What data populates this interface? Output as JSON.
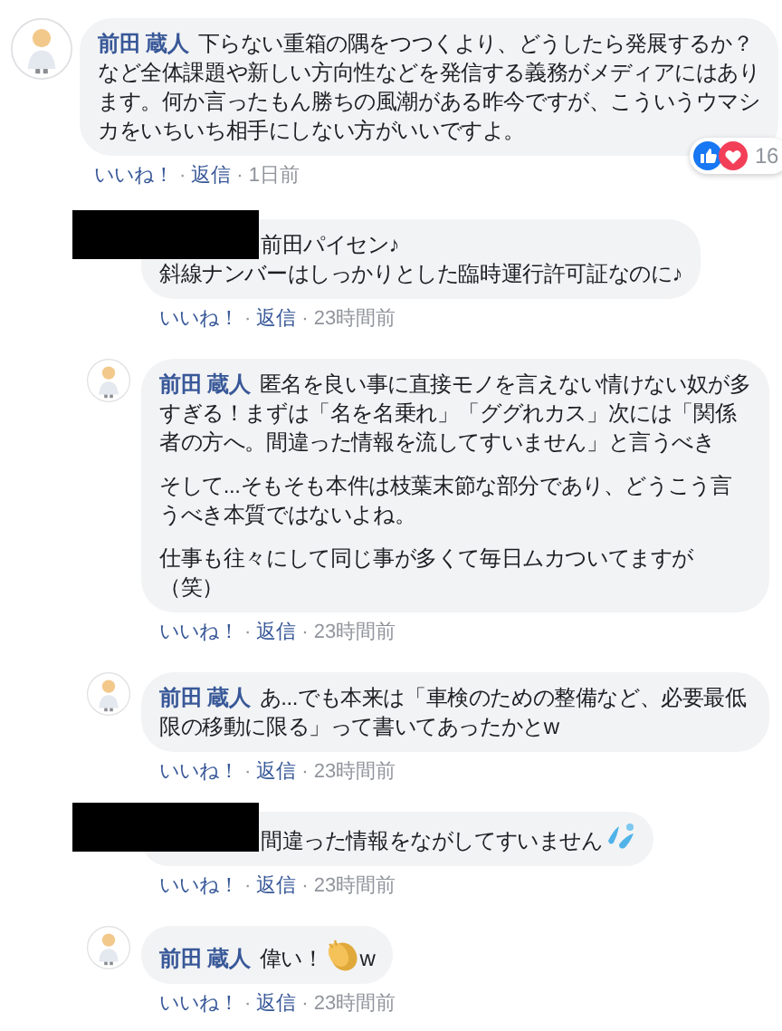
{
  "comment": {
    "author": "前田 蔵人",
    "author_hidden": false,
    "paragraphs": [
      "下らない重箱の隅をつつくより、どうしたら発展するか？など全体課題や新しい方向性などを発信する義務がメディアにはあります。何か言ったもん勝ちの風潮がある昨今ですが、こういうウマシカをいちいち相手にしない方がいいですよ。"
    ],
    "reaction_count": "16",
    "actions": [
      {
        "kind": "link",
        "text": "いいね！"
      },
      {
        "kind": "sep",
        "text": "·"
      },
      {
        "kind": "link",
        "text": "返信"
      },
      {
        "kind": "sep",
        "text": "·"
      },
      {
        "kind": "time",
        "text": "1日前"
      }
    ],
    "children": [
      {
        "author_hidden": true,
        "paragraphs": [
          "前田パイセン♪\n斜線ナンバーはしっかりとした臨時運行許可証なのに♪"
        ],
        "actions": [
          {
            "kind": "link",
            "text": "いいね！"
          },
          {
            "kind": "sep",
            "text": "·"
          },
          {
            "kind": "link",
            "text": "返信"
          },
          {
            "kind": "sep",
            "text": "·"
          },
          {
            "kind": "time",
            "text": "23時間前"
          }
        ]
      },
      {
        "author": "前田 蔵人",
        "author_hidden": false,
        "paragraphs": [
          "匿名を良い事に直接モノを言えない情けない奴が多すぎる！まずは「名を名乗れ」「ググれカス」次には「関係者の方へ。間違った情報を流してすいません」と言うべき",
          "そして...そもそも本件は枝葉末節な部分であり、どうこう言うべき本質ではないよね。",
          "仕事も往々にして同じ事が多くて毎日ムカついてますが（笑）"
        ],
        "actions": [
          {
            "kind": "link",
            "text": "いいね！"
          },
          {
            "kind": "sep",
            "text": "·"
          },
          {
            "kind": "link",
            "text": "返信"
          },
          {
            "kind": "sep",
            "text": "·"
          },
          {
            "kind": "time",
            "text": "23時間前"
          }
        ]
      },
      {
        "author": "前田 蔵人",
        "author_hidden": false,
        "paragraphs": [
          "あ...でも本来は「車検のための整備など、必要最低限の移動に限る」って書いてあったかとw"
        ],
        "actions": [
          {
            "kind": "link",
            "text": "いいね！"
          },
          {
            "kind": "sep",
            "text": "·"
          },
          {
            "kind": "link",
            "text": "返信"
          },
          {
            "kind": "sep",
            "text": "·"
          },
          {
            "kind": "time",
            "text": "23時間前"
          }
        ]
      },
      {
        "author_hidden": true,
        "paragraphs": [
          "間違った情報をながしてすいません"
        ],
        "trailing_icon": {
          "kind": "drops"
        },
        "actions": [
          {
            "kind": "link",
            "text": "いいね！"
          },
          {
            "kind": "sep",
            "text": "·"
          },
          {
            "kind": "link",
            "text": "返信"
          },
          {
            "kind": "sep",
            "text": "·"
          },
          {
            "kind": "time",
            "text": "23時間前"
          }
        ]
      },
      {
        "author": "前田 蔵人",
        "author_hidden": false,
        "paragraphs": [
          "偉い！"
        ],
        "trailing_icon": {
          "kind": "clap"
        },
        "tail": "w",
        "actions": [
          {
            "kind": "link",
            "text": "いいね！"
          },
          {
            "kind": "sep",
            "text": "·"
          },
          {
            "kind": "link",
            "text": "返信"
          },
          {
            "kind": "sep",
            "text": "·"
          },
          {
            "kind": "time",
            "text": "23時間前"
          }
        ]
      }
    ]
  }
}
